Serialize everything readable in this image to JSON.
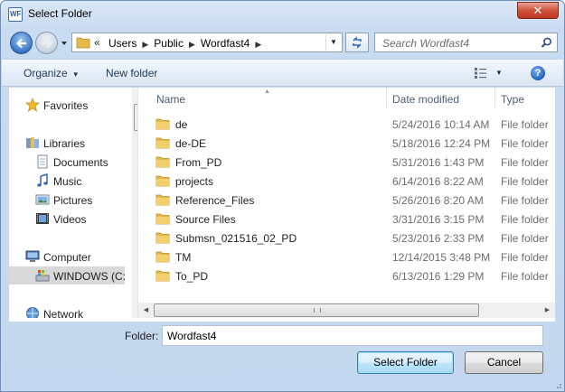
{
  "window": {
    "title": "Select Folder",
    "app_icon_text": "WF",
    "close_glyph": "✕"
  },
  "nav": {
    "breadcrumb_prefix": "«",
    "breadcrumbs": [
      "Users",
      "Public",
      "Wordfast4"
    ],
    "search_placeholder": "Search Wordfast4"
  },
  "toolbar": {
    "organize_label": "Organize",
    "new_folder_label": "New folder",
    "help_glyph": "?"
  },
  "sidebar": {
    "items": [
      {
        "label": "Favorites",
        "icon": "star-icon"
      },
      {
        "label": "Libraries",
        "icon": "libraries-icon"
      },
      {
        "label": "Documents",
        "icon": "documents-icon"
      },
      {
        "label": "Music",
        "icon": "music-icon"
      },
      {
        "label": "Pictures",
        "icon": "pictures-icon"
      },
      {
        "label": "Videos",
        "icon": "videos-icon"
      },
      {
        "label": "Computer",
        "icon": "computer-icon"
      },
      {
        "label": "WINDOWS (C:",
        "icon": "drive-icon",
        "selected": true
      },
      {
        "label": "Network",
        "icon": "network-icon"
      }
    ]
  },
  "file_list": {
    "columns": [
      "Name",
      "Date modified",
      "Type"
    ],
    "rows": [
      {
        "name": "de",
        "date": "5/24/2016 10:14 AM",
        "type": "File folder"
      },
      {
        "name": "de-DE",
        "date": "5/18/2016 12:24 PM",
        "type": "File folder"
      },
      {
        "name": "From_PD",
        "date": "5/31/2016 1:43 PM",
        "type": "File folder"
      },
      {
        "name": "projects",
        "date": "6/14/2016 8:22 AM",
        "type": "File folder"
      },
      {
        "name": "Reference_Files",
        "date": "5/26/2016 8:20 AM",
        "type": "File folder"
      },
      {
        "name": "Source Files",
        "date": "3/31/2016 3:15 PM",
        "type": "File folder"
      },
      {
        "name": "Submsn_021516_02_PD",
        "date": "5/23/2016 2:33 PM",
        "type": "File folder"
      },
      {
        "name": "TM",
        "date": "12/14/2015 3:48 PM",
        "type": "File folder"
      },
      {
        "name": "To_PD",
        "date": "6/13/2016 1:29 PM",
        "type": "File folder"
      }
    ]
  },
  "footer": {
    "folder_label": "Folder:",
    "folder_value": "Wordfast4",
    "select_button": "Select Folder",
    "cancel_button": "Cancel"
  },
  "colors": {
    "accent": "#3c7fb1",
    "folder": "#e8b94a",
    "title_bg": "#c9dcf1"
  }
}
